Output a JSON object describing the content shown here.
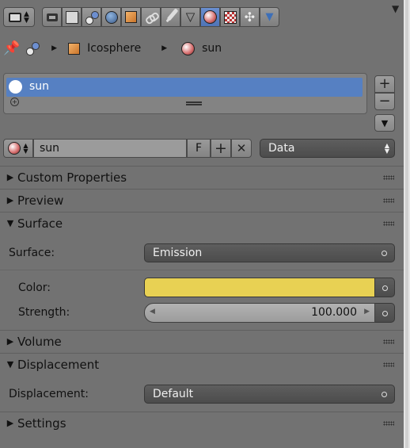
{
  "breadcrumb": {
    "object": "Icosphere",
    "material": "sun"
  },
  "material_list": {
    "items": [
      {
        "name": "sun"
      }
    ]
  },
  "datablock": {
    "name": "sun",
    "fake_user_label": "F",
    "link": "Data"
  },
  "panels": {
    "custom_properties": "Custom Properties",
    "preview": "Preview",
    "surface": "Surface",
    "volume": "Volume",
    "displacement": "Displacement",
    "settings": "Settings"
  },
  "surface": {
    "surface_label": "Surface:",
    "surface_value": "Emission",
    "color_label": "Color:",
    "color_value": "#e8d153",
    "strength_label": "Strength:",
    "strength_value": "100.000"
  },
  "displacement": {
    "label": "Displacement:",
    "value": "Default"
  }
}
